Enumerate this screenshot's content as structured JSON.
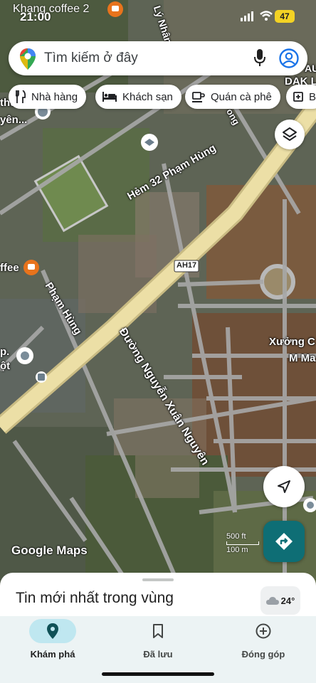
{
  "status_bar": {
    "carrier": "Khang coffee 2",
    "time": "21:00",
    "battery": "47"
  },
  "search": {
    "placeholder": "Tìm kiếm ở đây"
  },
  "chips": [
    {
      "label": "Nhà hàng",
      "icon": "fork-knife-icon"
    },
    {
      "label": "Khách sạn",
      "icon": "bed-icon"
    },
    {
      "label": "Quán cà phê",
      "icon": "coffee-cup-icon"
    },
    {
      "label": "B",
      "icon": "plus-box-icon"
    }
  ],
  "map_labels": {
    "ly_nhan": "Lý Nhân T",
    "dak": "DAK L",
    "au": "AU",
    "thu": "thu",
    "yen": "yên...",
    "hem32": "Hẻm 32 Phạm Hùng",
    "ong": "ong",
    "coffee": "ffee",
    "ah17": "AH17",
    "pham_hung": "Phạm Hùng",
    "duong_nguyen": "Đường Nguyễn Xuân Nguyên",
    "xuong": "Xưởng C",
    "m_ma": "M Ma",
    "p": "p.",
    "mot": "ột"
  },
  "map_footer": {
    "logo": "Google Maps",
    "scale_ft": "500 ft",
    "scale_m": "100 m"
  },
  "sheet": {
    "title": "Tin mới nhất trong vùng",
    "weather": "24°"
  },
  "nav": [
    {
      "label": "Khám phá",
      "icon": "explore-pin-icon",
      "active": true
    },
    {
      "label": "Đã lưu",
      "icon": "bookmark-icon",
      "active": false
    },
    {
      "label": "Đóng góp",
      "icon": "add-circle-icon",
      "active": false
    }
  ],
  "colors": {
    "accent": "#0e6e75",
    "highway": "#e8dba0",
    "nav_bg": "#ecf3f4",
    "active_pill": "#bfe7f0"
  }
}
